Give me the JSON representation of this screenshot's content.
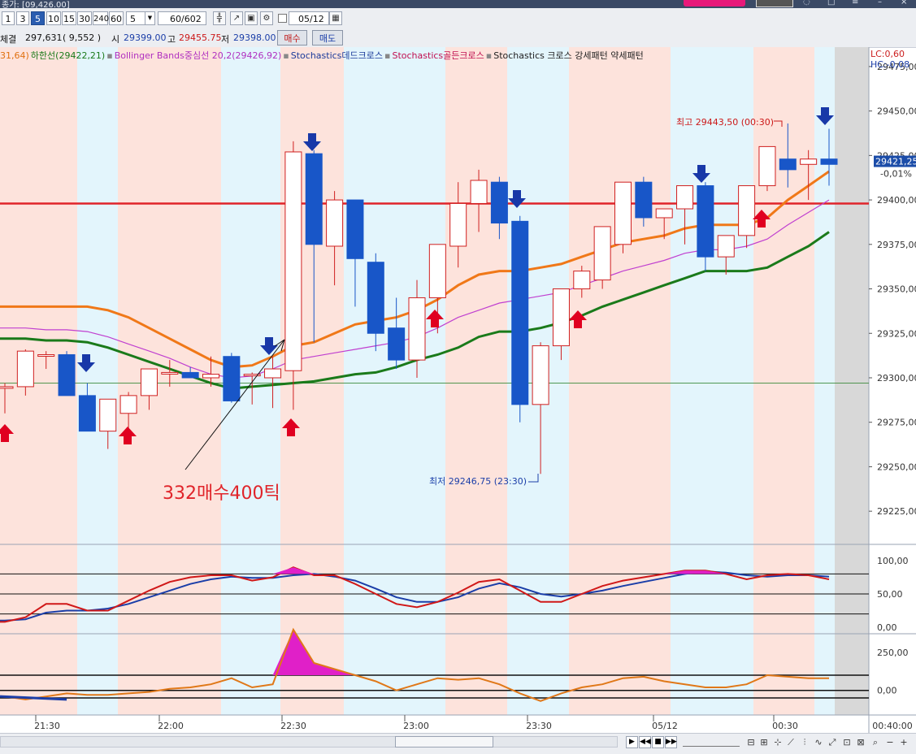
{
  "window": {
    "title": "종가: [09,426.00]"
  },
  "toolbar": {
    "periods": [
      "1",
      "3",
      "5",
      "10",
      "15",
      "30",
      "240",
      "60"
    ],
    "selected_period": "5",
    "period_select": "5",
    "count": "60",
    "count_total": "/602",
    "date": "05/12"
  },
  "quote": {
    "label_volume": "체결",
    "volume": "297,631",
    "change": "( 9,552 )",
    "open_label": "시",
    "open": "29399.00",
    "high_label": "고",
    "high": "29455.75",
    "low_label": "저",
    "low": "29398.00",
    "buy_label": "매수",
    "sell_label": "매도"
  },
  "legend": [
    {
      "text": "31,64)",
      "color": "#e07010"
    },
    {
      "text": "하한선(29422,21)",
      "color": "#1a7a1a"
    },
    {
      "text": "Bollinger Bands중심선 20,2(29426,92)",
      "color": "#b030c0"
    },
    {
      "text": "Stochastics데드크로스",
      "color": "#1a3a9a"
    },
    {
      "text": "Stochastics골든크로스",
      "color": "#c01050"
    },
    {
      "text": "Stochastics 크로스 강세패턴  약세패턴",
      "color": "#222222"
    }
  ],
  "price_axis": {
    "ticks": [
      "29475,00",
      "29450,00",
      "29425,00",
      "29400,00",
      "29375,00",
      "29350,00",
      "29325,00",
      "29300,00",
      "29275,00",
      "29250,00",
      "29225,00"
    ],
    "lc": "LC:0,60",
    "hc": "HC:-0,08",
    "current_price": "29421,25",
    "current_pct": "-0,01%"
  },
  "stoch_axis": {
    "ticks": [
      "100,00",
      "50,00",
      "0,00"
    ]
  },
  "osc_axis": {
    "ticks": [
      "250,00",
      "0,00"
    ]
  },
  "time_axis": {
    "labels": [
      "21:30",
      "22:00",
      "22:30",
      "23:00",
      "23:30",
      "05/12",
      "00:30",
      "00:40:00"
    ]
  },
  "annotations": {
    "high": "최고 29443,50 (00:30)",
    "low": "최저 29246,75 (23:30)",
    "note": "332매수400틱"
  },
  "colors": {
    "up": "#d02020",
    "down": "#1856c8",
    "ma_orange": "#f07818",
    "ma_green": "#1a7a1a",
    "bb_mid": "#c040d0",
    "pink_band": "#fde3dc",
    "blue_band": "#e3f5fc",
    "sell_arrow": "#1838a8",
    "buy_arrow": "#e00020",
    "level_line": "#e0242a"
  },
  "chart_data": {
    "type": "candlestick",
    "interval": "5min",
    "ylim": [
      29210,
      29485
    ],
    "level": 29398,
    "candles": [
      [
        29295,
        29297,
        29280,
        29295
      ],
      [
        29295,
        29316,
        29290,
        29315
      ],
      [
        29313,
        29315,
        29305,
        29313
      ],
      [
        29313,
        29315,
        29290,
        29290
      ],
      [
        29290,
        29297,
        29270,
        29270
      ],
      [
        29270,
        29285,
        29260,
        29288
      ],
      [
        29280,
        29292,
        29270,
        29290
      ],
      [
        29290,
        29305,
        29282,
        29305
      ],
      [
        29303,
        29310,
        29295,
        29303
      ],
      [
        29303,
        29306,
        29300,
        29300
      ],
      [
        29300,
        29312,
        29295,
        29302
      ],
      [
        29312,
        29314,
        29286,
        29287
      ],
      [
        29302,
        29303,
        29285,
        29302
      ],
      [
        29300,
        29312,
        29283,
        29305
      ],
      [
        29304,
        29433,
        29282,
        29427
      ],
      [
        29426,
        29428,
        29320,
        29375
      ],
      [
        29374,
        29405,
        29352,
        29400
      ],
      [
        29400,
        29380,
        29340,
        29367
      ],
      [
        29365,
        29370,
        29315,
        29325
      ],
      [
        29328,
        29345,
        29305,
        29310
      ],
      [
        29310,
        29355,
        29300,
        29345
      ],
      [
        29345,
        29375,
        29325,
        29375
      ],
      [
        29374,
        29410,
        29362,
        29398
      ],
      [
        29398,
        29417,
        29382,
        29411
      ],
      [
        29410,
        29413,
        29378,
        29387
      ],
      [
        29388,
        29391,
        29275,
        29285
      ],
      [
        29285,
        29320,
        29246,
        29318
      ],
      [
        29318,
        29350,
        29310,
        29350
      ],
      [
        29350,
        29363,
        29345,
        29360
      ],
      [
        29355,
        29380,
        29350,
        29385
      ],
      [
        29375,
        29410,
        29370,
        29410
      ],
      [
        29410,
        29413,
        29385,
        29390
      ],
      [
        29390,
        29392,
        29378,
        29395
      ],
      [
        29395,
        29403,
        29375,
        29408
      ],
      [
        29408,
        29410,
        29360,
        29368
      ],
      [
        29368,
        29380,
        29358,
        29380
      ],
      [
        29380,
        29408,
        29373,
        29408
      ],
      [
        29408,
        29430,
        29405,
        29430
      ],
      [
        29423,
        29443,
        29407,
        29417
      ],
      [
        29420,
        29428,
        29400,
        29423
      ],
      [
        29423,
        29440,
        29408,
        29420
      ]
    ],
    "series": [
      {
        "name": "상한선",
        "values": [
          29340,
          29340,
          29340,
          29340,
          29340,
          29338,
          29334,
          29328,
          29322,
          29316,
          29310,
          29306,
          29307,
          29312,
          29318,
          29320,
          29325,
          29330,
          29332,
          29334,
          29338,
          29344,
          29352,
          29358,
          29360,
          29360,
          29362,
          29364,
          29368,
          29372,
          29376,
          29378,
          29380,
          29384,
          29386,
          29386,
          29386,
          29390,
          29400,
          29408,
          29416
        ]
      },
      {
        "name": "Bollinger Bands중심선",
        "values": [
          29328,
          29328,
          29327,
          29327,
          29326,
          29323,
          29319,
          29315,
          29311,
          29306,
          29302,
          29300,
          29301,
          29305,
          29310,
          29312,
          29314,
          29316,
          29318,
          29320,
          29323,
          29328,
          29334,
          29338,
          29342,
          29344,
          29346,
          29348,
          29352,
          29356,
          29360,
          29363,
          29366,
          29370,
          29372,
          29372,
          29374,
          29378,
          29386,
          29393,
          29400
        ]
      },
      {
        "name": "하한선",
        "values": [
          29322,
          29322,
          29321,
          29321,
          29320,
          29317,
          29313,
          29309,
          29305,
          29301,
          29297,
          29294,
          29295,
          29296,
          29297,
          29298,
          29300,
          29302,
          29303,
          29306,
          29310,
          29313,
          29317,
          29323,
          29326,
          29326,
          29328,
          29331,
          29335,
          29340,
          29344,
          29348,
          29352,
          29356,
          29360,
          29360,
          29360,
          29362,
          29368,
          29374,
          29382
        ]
      }
    ],
    "stochastic": {
      "ylim": [
        0,
        100
      ],
      "fast": [
        8,
        15,
        35,
        35,
        25,
        25,
        40,
        55,
        68,
        75,
        78,
        78,
        70,
        75,
        90,
        78,
        78,
        65,
        50,
        35,
        30,
        38,
        52,
        68,
        72,
        55,
        38,
        38,
        50,
        62,
        70,
        75,
        80,
        85,
        85,
        80,
        72,
        78,
        80,
        78,
        72
      ],
      "slow": [
        10,
        12,
        22,
        25,
        25,
        28,
        35,
        45,
        55,
        65,
        72,
        76,
        74,
        74,
        78,
        80,
        76,
        70,
        58,
        45,
        38,
        38,
        45,
        58,
        66,
        60,
        50,
        46,
        50,
        55,
        62,
        68,
        74,
        80,
        84,
        82,
        78,
        76,
        78,
        78,
        76
      ]
    },
    "oscillator": {
      "ylim": [
        -130,
        330
      ],
      "values": [
        -40,
        -60,
        -40,
        -20,
        -30,
        -30,
        -20,
        -10,
        10,
        20,
        40,
        80,
        20,
        40,
        400,
        180,
        140,
        100,
        60,
        0,
        40,
        80,
        70,
        80,
        40,
        -20,
        -70,
        -20,
        20,
        40,
        80,
        90,
        60,
        40,
        20,
        20,
        40,
        100,
        90,
        80,
        80
      ]
    }
  }
}
